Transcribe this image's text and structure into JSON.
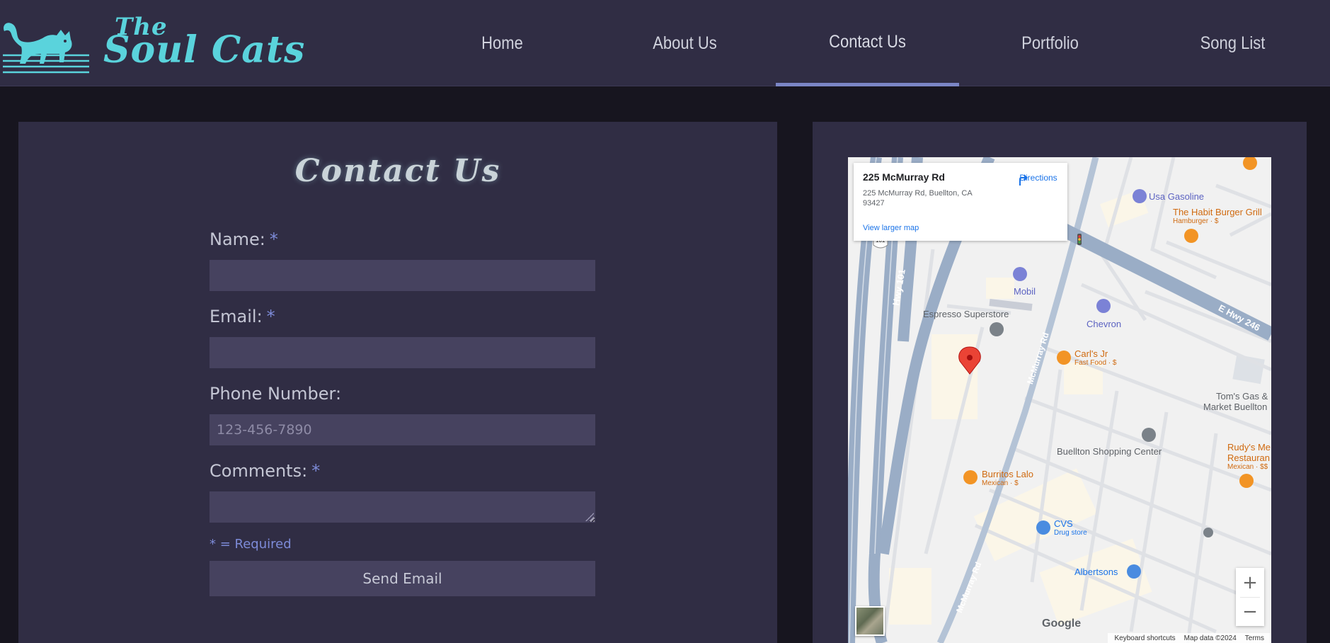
{
  "brand": {
    "the": "The",
    "name": "Soul Cats",
    "color": "#5ad3dc"
  },
  "nav": {
    "items": [
      {
        "label": "Home"
      },
      {
        "label": "About Us"
      },
      {
        "label": "Contact Us",
        "active": true
      },
      {
        "label": "Portfolio"
      },
      {
        "label": "Song List"
      }
    ],
    "accent": "#7b86c6"
  },
  "contact": {
    "title": "Contact Us",
    "fields": [
      {
        "label": "Name:",
        "required": "*",
        "value": "",
        "placeholder": ""
      },
      {
        "label": "Email:",
        "required": "*",
        "value": "",
        "placeholder": ""
      },
      {
        "label": "Phone Number:",
        "required": "",
        "value": "",
        "placeholder": "123-456-7890"
      },
      {
        "label": "Comments:",
        "required": "*",
        "value": "",
        "placeholder": ""
      }
    ],
    "required_note": "* = Required",
    "send_label": "Send Email"
  },
  "map": {
    "card": {
      "title": "225 McMurray Rd",
      "address": "225 McMurray Rd, Buellton, CA 93427",
      "larger_map": "View larger map",
      "directions": "Directions"
    },
    "places": {
      "usa_gasoline": "Usa Gasoline",
      "habit": "The Habit Burger Grill",
      "habit_sub": "Hamburger · $",
      "mobil": "Mobil",
      "espresso": "Espresso Superstore",
      "chevron": "Chevron",
      "carls": "Carl's Jr",
      "carls_sub": "Fast Food · $",
      "toms1": "Tom's Gas &",
      "toms2": "Market Buellton",
      "shopping": "Buellton Shopping Center",
      "rudys1": "Rudy's Me",
      "rudys2": "Restauran",
      "rudys_sub": "Mexican · $$",
      "burritos": "Burritos Lalo",
      "burritos_sub": "Mexican · $",
      "cvs": "CVS",
      "cvs_sub": "Drug store",
      "albertsons": "Albertsons"
    },
    "roads": {
      "hwy101": "Hwy 101",
      "mcmurray": "McMurray Rd",
      "ehwy": "E Hwy 246",
      "shield": "101"
    },
    "zoom_in": "+",
    "zoom_out": "−",
    "google": "Google",
    "footer": {
      "shortcuts": "Keyboard shortcuts",
      "data": "Map data ©2024",
      "terms": "Terms"
    }
  }
}
